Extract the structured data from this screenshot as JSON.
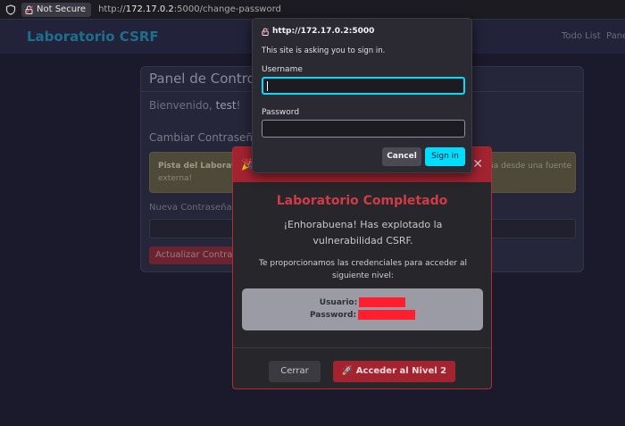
{
  "browser": {
    "security_label": "Not Secure",
    "url_scheme": "http://",
    "url_host": "172.17.0.2",
    "url_path": ":5000/change-password"
  },
  "site": {
    "brand": "Laboratorio CSRF",
    "nav": [
      "Todo List",
      "Pane"
    ]
  },
  "panel": {
    "title": "Panel de Control",
    "welcome_prefix": "Bienvenido, ",
    "welcome_user": "test",
    "welcome_suffix": "!",
    "section_title": "Cambiar Contraseña",
    "hint_bold": "Pista del Laborato",
    "hint_text_right": "ña desde una fuente",
    "hint_text_line2": "externa!",
    "new_password_label": "Nueva Contraseña",
    "update_button": "Actualizar Contraseña"
  },
  "modal": {
    "icon": "party-popper-icon",
    "close": "✕",
    "title": "Laboratorio Completado",
    "message": "¡Enhorabuena! Has explotado la vulnerabilidad CSRF.",
    "sub": "Te proporcionamos las credenciales para acceder al siguiente nivel:",
    "user_label": "Usuario:",
    "password_label": "Password:",
    "cancel_button": "Cerrar",
    "next_button": "🚀 Acceder al Nivel 2"
  },
  "auth_dialog": {
    "origin": "http://172.17.0.2:5000",
    "message": "This site is asking you to sign in.",
    "username_label": "Username",
    "username_value": "",
    "password_label": "Password",
    "password_value": "",
    "cancel_button": "Cancel",
    "signin_button": "Sign in"
  },
  "colors": {
    "accent": "#00ddff",
    "danger": "#a32431",
    "redaction": "#ff1e2e"
  }
}
